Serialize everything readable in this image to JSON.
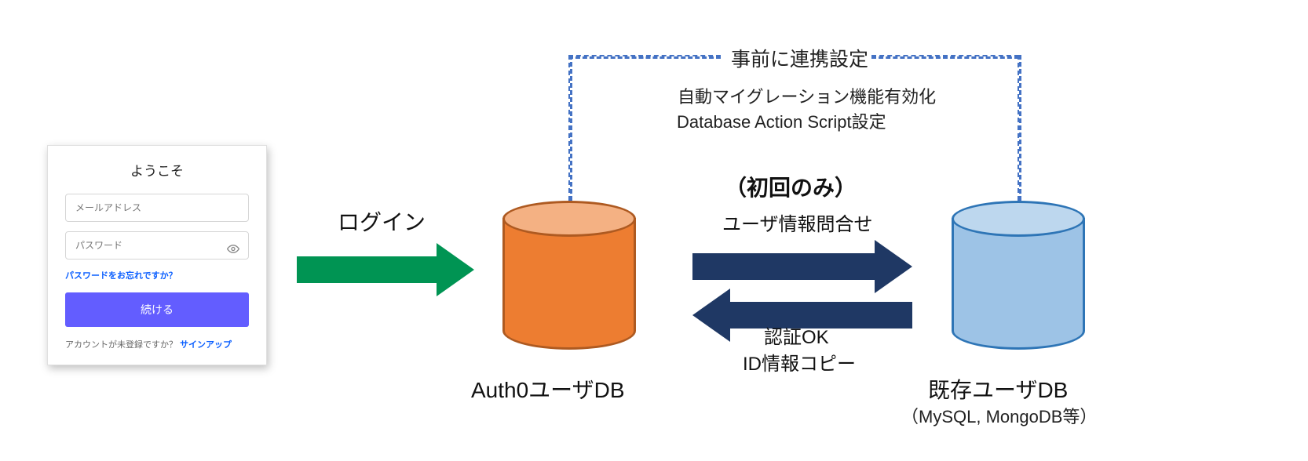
{
  "login": {
    "title": "ようこそ",
    "email_placeholder": "メールアドレス",
    "password_placeholder": "パスワード",
    "forgot": "パスワードをお忘れですか？",
    "continue": "続ける",
    "signup_prompt": "アカウントが未登録ですか？ ",
    "signup_link": "サインアップ"
  },
  "labels": {
    "login_arrow": "ログイン",
    "auth0_db": "Auth0ユーザDB",
    "first_time": "（初回のみ）",
    "user_query": "ユーザ情報問合せ",
    "auth_ok": "認証OK",
    "id_copy": "ID情報コピー",
    "existing_db": "既存ユーザDB",
    "existing_db_sub": "（MySQL, MongoDB等）",
    "preconfig": "事前に連携設定",
    "preconfig_sub1": "自動マイグレーション機能有効化",
    "preconfig_sub2": "Database Action Script設定"
  }
}
